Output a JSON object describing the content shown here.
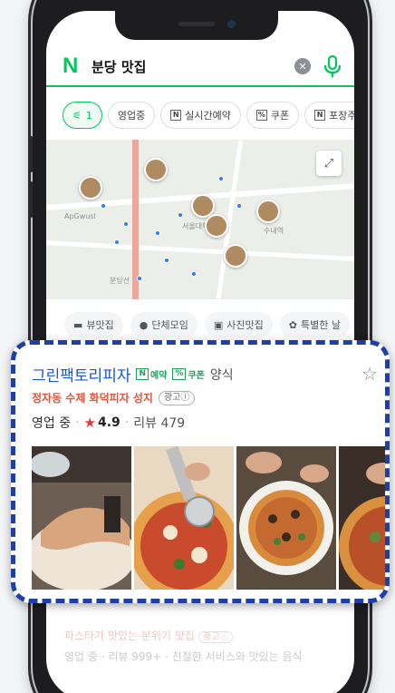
{
  "search": {
    "query": "분당 맛집"
  },
  "filters": [
    {
      "label": "1",
      "active": true
    },
    {
      "label": "영업중"
    },
    {
      "label": "실시간예약",
      "badge": "N"
    },
    {
      "label": "쿠폰",
      "badge": "%"
    },
    {
      "label": "포장주",
      "badge": "N"
    }
  ],
  "map": {
    "labels": [
      "ApGwusl",
      "서울대학교",
      "분당선",
      "수내역"
    ]
  },
  "categories": [
    {
      "label": "뷰맛집",
      "icon": "landscape-icon"
    },
    {
      "label": "단체모임",
      "icon": "people-icon"
    },
    {
      "label": "사진맛집",
      "icon": "camera-icon"
    },
    {
      "label": "특별한 날",
      "icon": "flower-icon"
    }
  ],
  "result": {
    "name": "그린팩토리피자",
    "tag_reserve": "예약",
    "tag_reserve_box": "N",
    "tag_coupon": "쿠폰",
    "tag_coupon_box": "%",
    "category": "양식",
    "promo": "정자동 수제 화덕피자 성지",
    "ad_label": "광고ⓘ",
    "status": "영업 중",
    "rating": "4.9",
    "review": "리뷰 479"
  },
  "faded_items": {
    "promo": "파스타가 맛있는 분위기 맛집",
    "ad": "광고ⓘ",
    "meta": "영업 중 · 리뷰 999+ · 친절한 서비스와 맛있는 음식"
  },
  "colors": {
    "naver_green": "#03c75a",
    "highlight_border": "#1f3fa3",
    "name_blue": "#1a57c9",
    "promo_red": "#e2573b"
  }
}
